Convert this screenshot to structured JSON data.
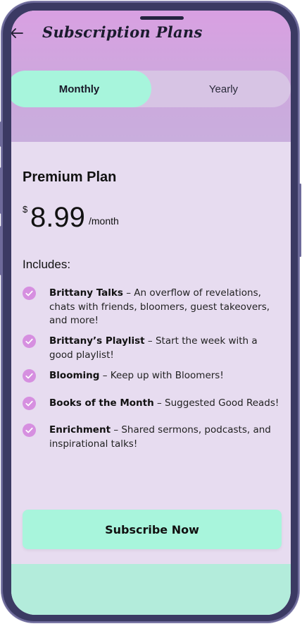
{
  "header": {
    "title": "Subscription Plans"
  },
  "billing_toggle": {
    "monthly_label": "Monthly",
    "yearly_label": "Yearly",
    "selected": "Monthly"
  },
  "plan": {
    "name": "Premium Plan",
    "currency": "$",
    "price": "8.99",
    "period": "/month",
    "includes_label": "Includes:",
    "features": [
      {
        "name": "Brittany Talks",
        "desc": " – An overflow of revelations, chats with friends, bloomers, guest takeovers, and more!"
      },
      {
        "name": "Brittany’s Playlist",
        "desc": " – Start the week with a good playlist!"
      },
      {
        "name": "Blooming",
        "desc": " – Keep up with Bloomers!"
      },
      {
        "name": "Books of the Month",
        "desc": " – Suggested Good Reads!"
      },
      {
        "name": "Enrichment",
        "desc": " – Shared sermons, podcasts, and inspirational talks!"
      }
    ]
  },
  "actions": {
    "subscribe_label": "Subscribe Now"
  },
  "colors": {
    "accent_mint": "#a7f5dc",
    "header_purple": "#d9a0e2",
    "check_purple": "#d68fe0",
    "card_bg": "#e7dcf0"
  },
  "icons": {
    "back": "arrow-left-icon",
    "feature": "check-circle-icon"
  }
}
